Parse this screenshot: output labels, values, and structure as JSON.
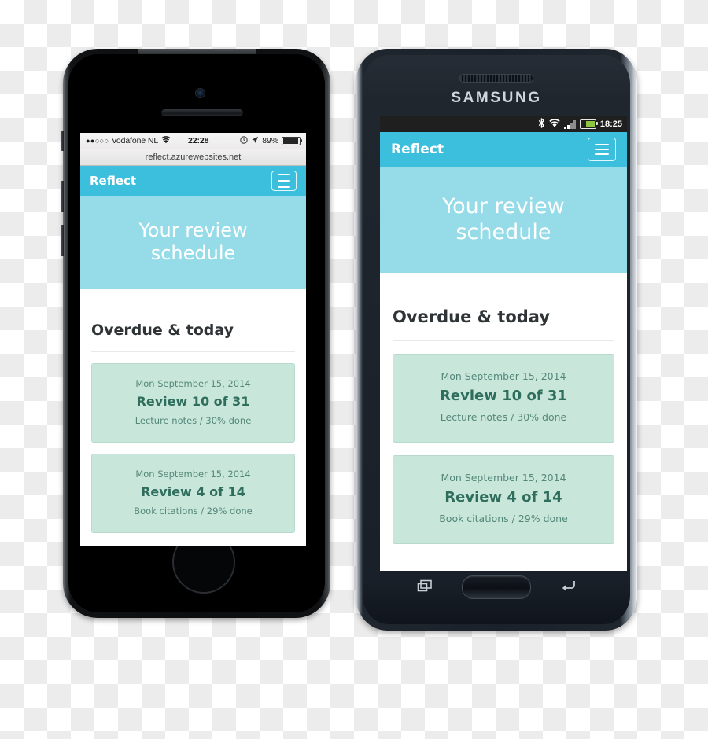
{
  "colors": {
    "navbar": "#3bbfdd",
    "hero": "#96dbe8",
    "card_bg": "#c9e6db",
    "card_border": "#b6dbcd",
    "card_title_text": "#2f6e5c",
    "card_meta_text": "#54887a",
    "heading_text": "#2f3436",
    "android_battery_fill": "#8ec63f"
  },
  "app": {
    "brand": "Reflect",
    "menu_icon": "hamburger-menu-icon",
    "hero_title_line1": "Your review",
    "hero_title_line2": "schedule",
    "hero_title": "Your review schedule",
    "section_title": "Overdue & today",
    "cards": [
      {
        "date": "Mon September 15, 2014",
        "title": "Review 10 of 31",
        "meta": "Lecture notes / 30% done"
      },
      {
        "date": "Mon September 15, 2014",
        "title": "Review 4 of 14",
        "meta": "Book citations / 29% done"
      }
    ]
  },
  "iphone": {
    "device_name": "iPhone",
    "status": {
      "signal_dots": "●●○○○",
      "carrier": "vodafone NL",
      "wifi_icon": "wifi-icon",
      "time": "22:28",
      "alarm_icon": "alarm-clock-icon",
      "location_icon": "location-arrow-icon",
      "battery_percent": "89%",
      "battery_icon": "battery-icon"
    },
    "browser": {
      "url": "reflect.azurewebsites.net"
    },
    "hardware": {
      "camera": "front-camera",
      "speaker": "earpiece-speaker",
      "home_button": "home-button",
      "mute_switch": "mute-switch",
      "volume_up": "volume-up-button",
      "volume_down": "volume-down-button"
    }
  },
  "samsung": {
    "device_name": "Samsung",
    "brand_text": "SAMSUNG",
    "status": {
      "bluetooth_icon": "bluetooth-icon",
      "wifi_icon": "wifi-icon",
      "signal_icon": "signal-bars-icon",
      "battery_icon": "battery-icon",
      "time": "18:25"
    },
    "nav": {
      "recents_icon": "recent-apps-icon",
      "home_icon": "home-button",
      "back_icon": "back-arrow-icon"
    },
    "hardware": {
      "speaker": "earpiece-speaker"
    }
  }
}
